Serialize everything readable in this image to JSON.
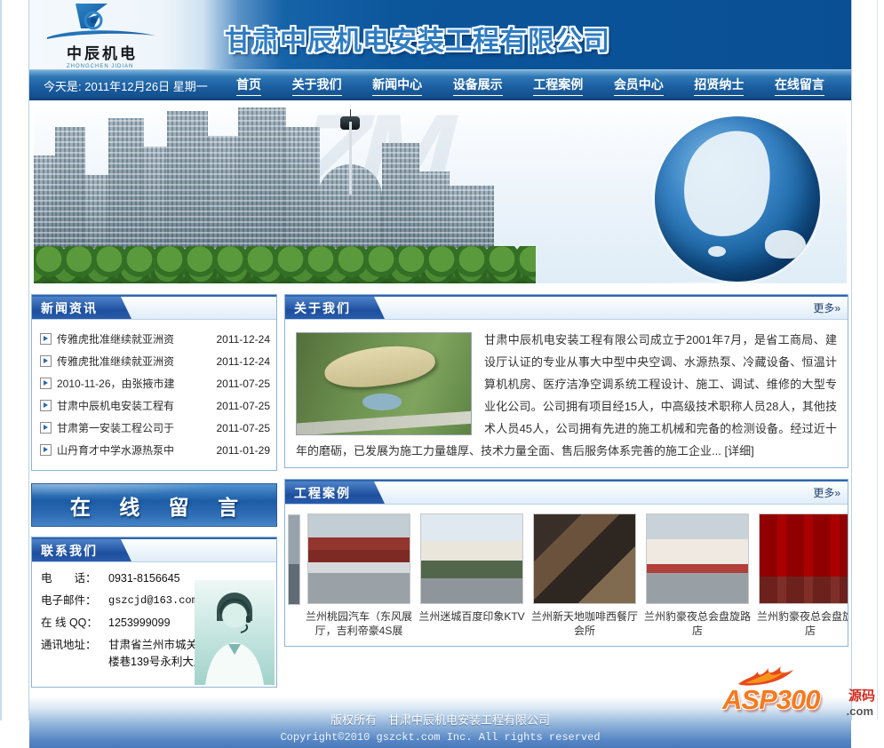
{
  "header": {
    "logo_cn": "中辰机电",
    "logo_en": "ZHONGCHEN JIDIAN",
    "company_title": "甘肃中辰机电安装工程有限公司"
  },
  "navbar": {
    "date_text": "今天是: 2011年12月26日 星期一",
    "items": [
      {
        "label": "首页"
      },
      {
        "label": "关于我们"
      },
      {
        "label": "新闻中心"
      },
      {
        "label": "设备展示"
      },
      {
        "label": "工程案例"
      },
      {
        "label": "会员中心"
      },
      {
        "label": "招贤纳士"
      },
      {
        "label": "在线留言"
      }
    ]
  },
  "news": {
    "title": "新闻资讯",
    "items": [
      {
        "text": "传雅虎批准继续就亚洲资",
        "date": "2011-12-24"
      },
      {
        "text": "传雅虎批准继续就亚洲资",
        "date": "2011-12-24"
      },
      {
        "text": "2010-11-26，由张掖市建",
        "date": "2011-07-25"
      },
      {
        "text": "甘肃中辰机电安装工程有",
        "date": "2011-07-25"
      },
      {
        "text": "甘肃第一安装工程公司于",
        "date": "2011-07-25"
      },
      {
        "text": "山丹育才中学水源热泵中",
        "date": "2011-01-29"
      }
    ]
  },
  "about": {
    "title": "关于我们",
    "more": "更多»",
    "text": "甘肃中辰机电安装工程有限公司成立于2001年7月，是省工商局、建设厅认证的专业从事大中型中央空调、水源热泵、冷藏设备、恒温计算机机房、医疗洁净空调系统工程设计、施工、调试、维修的大型专业化公司。公司拥有项目经15人，中高级技术职称人员28人，其他技术人员45人，公司拥有先进的施工机械和完备的检测设备。经过近十年的磨砺，已发展为施工力量雄厚、技术力量全面、售后服务体系完善的施工企业...",
    "detail": "[详细]"
  },
  "guestbook": {
    "label": "在 线 留 言"
  },
  "contact": {
    "title": "联系我们",
    "rows": [
      {
        "label": "电　　话：",
        "value": "0931-8156645"
      },
      {
        "label": "电子邮件：",
        "value": "gszcjd@163.com"
      },
      {
        "label": "在 线 QQ：",
        "value": "1253999099"
      },
      {
        "label": "通讯地址：",
        "value": "甘肃省兰州市城关区鼓楼巷139号永利大厦6层"
      }
    ]
  },
  "cases": {
    "title": "工程案例",
    "more": "更多»",
    "items": [
      {
        "caption": "兰州桃园汽车（东风展厅，吉利帝豪4S展"
      },
      {
        "caption": "兰州迷城百度印象KTV"
      },
      {
        "caption": "兰州新天地咖啡西餐厅会所"
      },
      {
        "caption": "兰州豹豪夜总会盘旋路店"
      },
      {
        "caption": "兰州豹豪夜总会盘旋路店"
      }
    ]
  },
  "footer": {
    "line1": "版权所有　甘肃中辰机电安装工程有限公司",
    "line2": "Copyright©2010 gszckt.com Inc. All rights reserved",
    "watermark_text": "ASP300",
    "watermark_yuanma": "源码",
    "watermark_com": ".com"
  },
  "colors": {
    "header_blue": "#0b559b",
    "nav_blue": "#1c5ea2",
    "tab_blue": "#1d4f9e",
    "title_text_blue": "#2e7cc2",
    "footer_blue": "#4a7ab9",
    "watermark_orange": "#f47b20"
  }
}
